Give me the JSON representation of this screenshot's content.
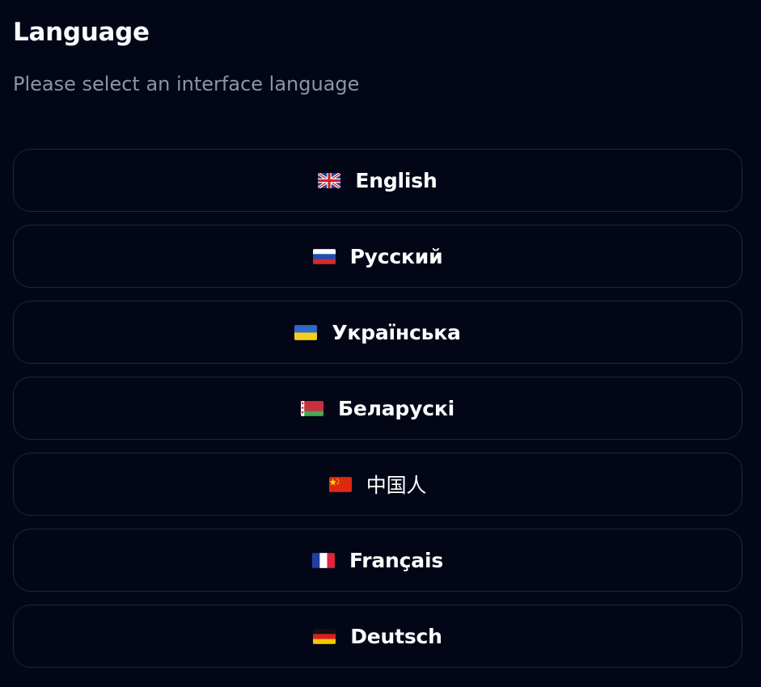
{
  "header": {
    "title": "Language",
    "subtitle": "Please select an interface language"
  },
  "languages": [
    {
      "label": "English",
      "flag": "uk-flag-icon"
    },
    {
      "label": "Русский",
      "flag": "russia-flag-icon"
    },
    {
      "label": "Українська",
      "flag": "ukraine-flag-icon"
    },
    {
      "label": "Беларускі",
      "flag": "belarus-flag-icon"
    },
    {
      "label": "中国人",
      "flag": "china-flag-icon"
    },
    {
      "label": "Français",
      "flag": "france-flag-icon"
    },
    {
      "label": "Deutsch",
      "flag": "germany-flag-icon"
    }
  ],
  "colors": {
    "background": "#020617",
    "button_border": "#1f2937",
    "subtitle": "#8b95a7",
    "text": "#ffffff"
  }
}
